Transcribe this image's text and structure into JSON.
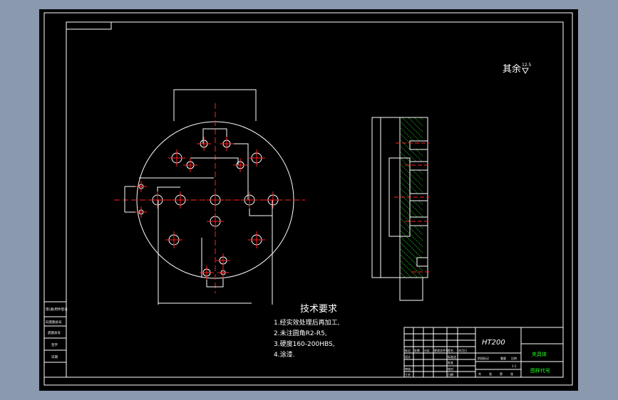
{
  "drawing": {
    "roughness_note": "其余",
    "roughness_value": "12.5",
    "tech_requirements": {
      "title": "技术要求",
      "items": [
        "1.经实效处理后再加工,",
        "2.未注圆角R2-R5,",
        "3.硬度160-200HBS,",
        "4.涂漆."
      ]
    },
    "title_block": {
      "material": "HT200",
      "part_name": "夹具体",
      "drawing_code": "图样代号",
      "header_cells": [
        "标记",
        "处数",
        "分区",
        "更改文件号",
        "签名",
        "年月日"
      ],
      "role_labels": [
        "设计",
        "审核",
        "工艺"
      ],
      "mid_labels": [
        "标准化",
        "批准",
        "校对",
        "日期"
      ],
      "stage_labels": [
        "阶段标记",
        "重量",
        "比例"
      ],
      "scale": "1:1",
      "sheet_labels": [
        "共",
        "张",
        "第",
        "张"
      ]
    },
    "side_strip": [
      "借(通)用件登记",
      "旧底图总号",
      "底图总号",
      "签字",
      "日期"
    ]
  },
  "colors": {
    "background": "#8a99ae",
    "paper": "#000000",
    "line": "#ffffff",
    "center": "#ff2020",
    "hatch": "#22ff22"
  }
}
